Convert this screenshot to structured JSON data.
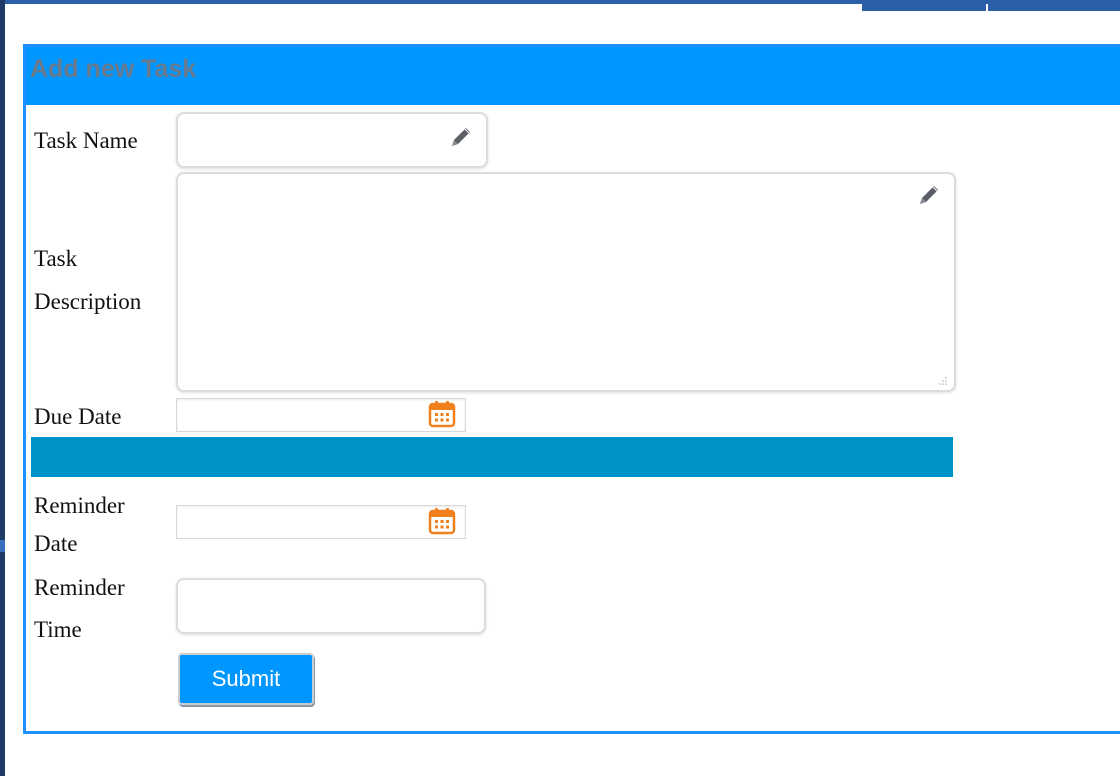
{
  "form": {
    "title": "Add new Task",
    "task_name_label": "Task Name",
    "task_description_label_line1": "Task",
    "task_description_label_line2": "Description",
    "due_date_label": "Due Date",
    "reminder_date_label_line1": "Reminder",
    "reminder_date_label_line2": "Date",
    "reminder_time_label_line1": "Reminder",
    "reminder_time_label_line2": "Time",
    "submit_label": "Submit",
    "task_name_value": "",
    "task_description_value": "",
    "due_date_value": "",
    "reminder_date_value": "",
    "reminder_time_value": ""
  },
  "icons": {
    "edit": "pencil-icon",
    "calendar": "calendar-icon"
  },
  "colors": {
    "header": "#0096ff",
    "divider": "#0093c8",
    "title_text": "#6b7a8c",
    "calendar_accent": "#f07f1d",
    "submit_bg": "#0096ff"
  }
}
